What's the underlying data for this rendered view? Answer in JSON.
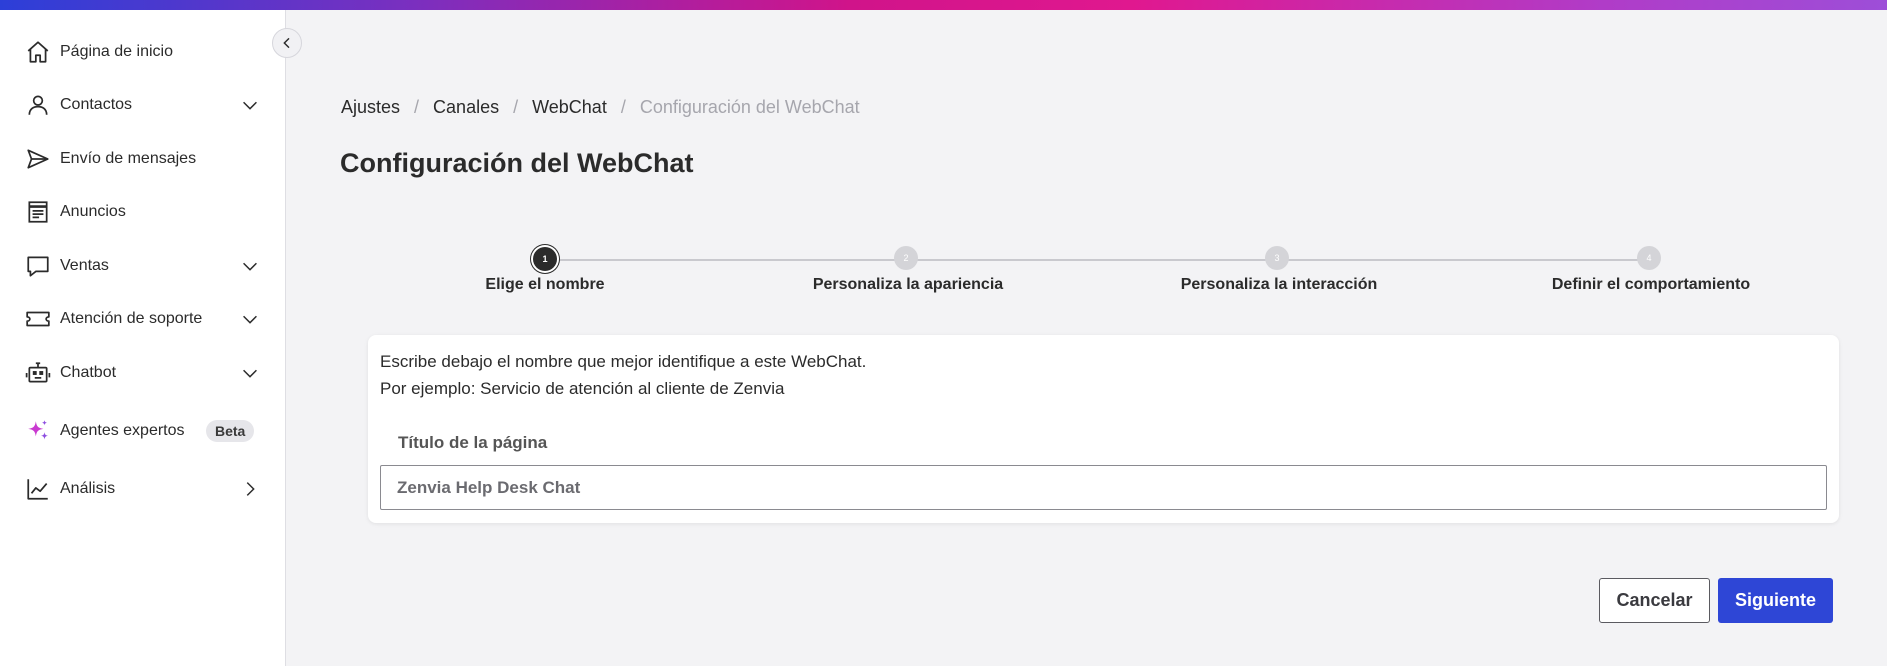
{
  "sidebar": {
    "items": [
      {
        "label": "Página de inicio",
        "icon": "home-icon"
      },
      {
        "label": "Contactos",
        "icon": "user-icon",
        "chevron": "chevron-down-icon"
      },
      {
        "label": "Envío de mensajes",
        "icon": "send-icon"
      },
      {
        "label": "Anuncios",
        "icon": "document-icon"
      },
      {
        "label": "Ventas",
        "icon": "chat-bubble-icon",
        "chevron": "chevron-down-icon"
      },
      {
        "label": "Atención de soporte",
        "icon": "ticket-icon",
        "chevron": "chevron-down-icon"
      },
      {
        "label": "Chatbot",
        "icon": "robot-icon",
        "chevron": "chevron-down-icon"
      },
      {
        "label": "Agentes expertos",
        "icon": "sparkles-icon",
        "badge": "Beta"
      },
      {
        "label": "Análisis",
        "icon": "chart-line-icon",
        "chevron": "chevron-right-icon"
      }
    ],
    "collapse_icon": "chevron-left-icon"
  },
  "breadcrumb": {
    "items": [
      "Ajustes",
      "Canales",
      "WebChat",
      "Configuración del WebChat"
    ],
    "separator": "/"
  },
  "page": {
    "title": "Configuración del WebChat"
  },
  "stepper": {
    "steps": [
      {
        "number": "1",
        "label": "Elige el nombre",
        "active": true
      },
      {
        "number": "2",
        "label": "Personaliza la apariencia",
        "active": false
      },
      {
        "number": "3",
        "label": "Personaliza la interacción",
        "active": false
      },
      {
        "number": "4",
        "label": "Definir el comportamiento",
        "active": false
      }
    ]
  },
  "form": {
    "description_line1": "Escribe debajo el nombre que mejor identifique a este WebChat.",
    "description_line2": "Por ejemplo: Servicio de atención al cliente de Zenvia",
    "field_label": "Título de la página",
    "field_value": "Zenvia Help Desk Chat"
  },
  "actions": {
    "cancel": "Cancelar",
    "next": "Siguiente"
  },
  "colors": {
    "primary": "#2e46d6",
    "accent_magenta": "#d0148a",
    "sparkle": "#c93ad0"
  }
}
